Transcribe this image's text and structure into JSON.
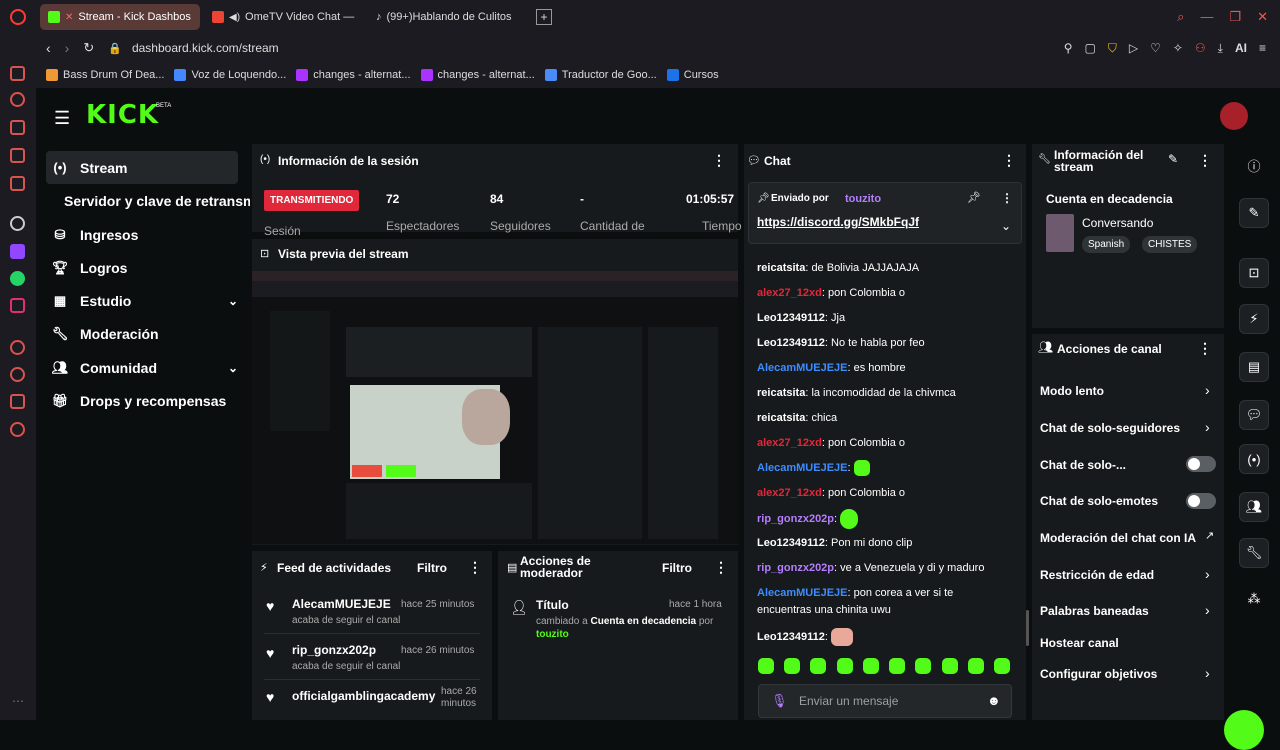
{
  "browser": {
    "tabs": [
      {
        "label": "Stream - Kick Dashbos"
      },
      {
        "label": "OmeTV Video Chat —"
      },
      {
        "label": "(99+)Hablando de Culitos"
      }
    ],
    "url": "dashboard.kick.com/stream",
    "ai_label": "AI",
    "bookmarks": [
      "Bass Drum Of Dea...",
      "Voz de Loquendo...",
      "changes - alternat...",
      "changes - alternat...",
      "Traductor de Goo...",
      "Cursos"
    ]
  },
  "brand": {
    "logo": "KICK",
    "beta": "BETA",
    "accent": "#53fc18"
  },
  "sidebar": {
    "items": [
      {
        "label": "Stream",
        "icon": "broadcast-icon"
      },
      {
        "label": "Servidor y clave de retransm"
      },
      {
        "label": "Ingresos",
        "icon": "coins-icon"
      },
      {
        "label": "Logros",
        "icon": "trophy-icon"
      },
      {
        "label": "Estudio",
        "icon": "grid-icon"
      },
      {
        "label": "Moderación",
        "icon": "wrench-icon"
      },
      {
        "label": "Comunidad",
        "icon": "users-icon"
      },
      {
        "label": "Drops y recompensas",
        "icon": "gift-icon"
      }
    ]
  },
  "session": {
    "title": "Información de la sesión",
    "status": "TRANSMITIENDO",
    "label_session": "Sesión",
    "stats": [
      {
        "value": "72",
        "label": "Espectadores"
      },
      {
        "value": "84",
        "label": "Seguidores"
      },
      {
        "value": "-",
        "label": "Cantidad de"
      },
      {
        "value": "01:05:57",
        "label": "Tiempo"
      }
    ]
  },
  "preview": {
    "title": "Vista previa del stream"
  },
  "activity": {
    "title": "Feed de actividades",
    "filter": "Filtro",
    "items": [
      {
        "name": "AlecamMUEJEJE",
        "time": "hace 25 minutos",
        "desc": "acaba de seguir el canal"
      },
      {
        "name": "rip_gonzx202p",
        "time": "hace 26 minutos",
        "desc": "acaba de seguir el canal"
      },
      {
        "name": "officialgamblingacademy",
        "time": "hace 26 minutos",
        "desc": ""
      }
    ]
  },
  "modactions": {
    "title": "Acciones de moderador",
    "filter": "Filtro",
    "item": {
      "title": "Título",
      "time": "hace 1 hora",
      "desc_pre": "cambiado a",
      "desc_bold": "Cuenta en decadencia",
      "desc_post": "por",
      "by": "touzito"
    }
  },
  "chat": {
    "title": "Chat",
    "pinned_by_label": "Enviado por",
    "pinned_user": "touzito",
    "pinned_link": "https://discord.gg/SMkbFqJf",
    "messages": [
      {
        "user": "reicatsita",
        "text": "de Bolivia JAJJAJAJA",
        "color": "white"
      },
      {
        "user": "alex27_12xd",
        "text": "pon Colombia o",
        "color": "red"
      },
      {
        "user": "Leo12349112",
        "text": "Jja",
        "color": "white"
      },
      {
        "user": "Leo12349112",
        "text": "No te habla por feo",
        "color": "white"
      },
      {
        "user": "AlecamMUEJEJE",
        "text": "es hombre",
        "color": "blue"
      },
      {
        "user": "reicatsita",
        "text": "la incomodidad de la chivmca",
        "color": "white"
      },
      {
        "user": "reicatsita",
        "text": "chica",
        "color": "white"
      },
      {
        "user": "alex27_12xd",
        "text": "pon Colombia o",
        "color": "red"
      },
      {
        "user": "AlecamMUEJEJE",
        "text": "",
        "color": "blue"
      },
      {
        "user": "alex27_12xd",
        "text": "pon Colombia o",
        "color": "red"
      },
      {
        "user": "rip_gonzx202p",
        "text": "",
        "color": "purple"
      },
      {
        "user": "Leo12349112",
        "text": "Pon mi dono clip",
        "color": "white"
      },
      {
        "user": "rip_gonzx202p",
        "text": "ve a Venezuela y di y maduro",
        "color": "purple"
      },
      {
        "user": "AlecamMUEJEJE",
        "text": "pon corea a ver si te",
        "color": "blue"
      },
      {
        "user": "",
        "text": "encuentras una chinita uwu",
        "color": "white"
      },
      {
        "user": "Leo12349112",
        "text": "",
        "color": "white"
      }
    ],
    "input_placeholder": "Enviar un mensaje"
  },
  "streaminfo": {
    "title": "Información del stream",
    "stream_title": "Cuenta en decadencia",
    "category": "Conversando",
    "tags": [
      "Spanish",
      "CHISTES"
    ]
  },
  "channel_actions": {
    "title": "Acciones de canal",
    "items": [
      {
        "label": "Modo lento",
        "control": "chevron"
      },
      {
        "label": "Chat de solo-seguidores",
        "control": "chevron"
      },
      {
        "label": "Chat de solo-...",
        "control": "toggle"
      },
      {
        "label": "Chat de solo-emotes",
        "control": "toggle"
      },
      {
        "label": "Moderación del chat con IA",
        "control": "external"
      },
      {
        "label": "Restricción de edad",
        "control": "chevron"
      },
      {
        "label": "Palabras baneadas",
        "control": "chevron"
      },
      {
        "label": "Hostear canal",
        "control": "none"
      },
      {
        "label": "Configurar objetivos",
        "control": "chevron"
      }
    ]
  }
}
